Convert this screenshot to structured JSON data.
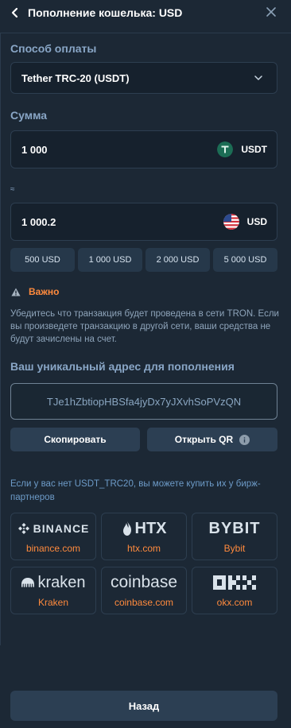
{
  "header": {
    "title": "Пополнение кошелька: USD"
  },
  "payment": {
    "label": "Способ оплаты",
    "selected": "Tether TRC-20 (USDT)"
  },
  "amount": {
    "label": "Сумма",
    "crypto_value": "1 000",
    "crypto_currency": "USDT",
    "approx_symbol": "≈",
    "fiat_value": "1 000.2",
    "fiat_currency": "USD"
  },
  "presets": [
    "500 USD",
    "1 000 USD",
    "2 000 USD",
    "5 000 USD"
  ],
  "warning": {
    "title": "Важно",
    "text": "Убедитесь что транзакция будет проведена в сети TRON. Если вы произведете транзакцию в другой сети, ваши средства не будут зачислены на счет."
  },
  "address": {
    "label": "Ваш уникальный адрес для пополнения",
    "value": "TJe1hZbtiopHBSfa4jyDx7yJXvhSoPVzQN"
  },
  "actions": {
    "copy": "Скопировать",
    "qr": "Открыть QR"
  },
  "partners": {
    "text": "Если у вас нет USDT_TRC20, вы можете купить их у бирж-партнеров",
    "items": [
      {
        "logo": "BINANCE",
        "link": "binance.com"
      },
      {
        "logo": "HTX",
        "link": "htx.com"
      },
      {
        "logo": "BYBIT",
        "link": "Bybit"
      },
      {
        "logo": "kraken",
        "link": "Kraken"
      },
      {
        "logo": "coinbase",
        "link": "coinbase.com"
      },
      {
        "logo": "OKX",
        "link": "okx.com"
      }
    ]
  },
  "footer": {
    "back": "Назад"
  },
  "colors": {
    "accent": "#ff8a3d",
    "label": "#89a6c6",
    "tether": "#26a17b"
  }
}
